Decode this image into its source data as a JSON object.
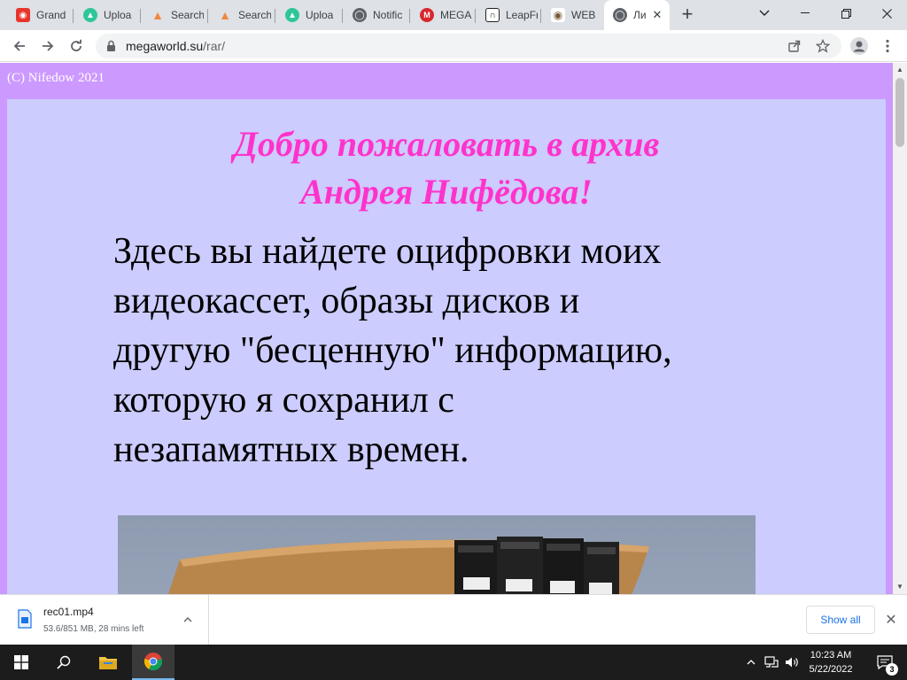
{
  "browser": {
    "tabs": [
      {
        "label": "Grand",
        "icon": "red-bag-icon",
        "color": "#e8352b"
      },
      {
        "label": "Uploa",
        "icon": "upload-logo-icon",
        "color": "#2fc59b"
      },
      {
        "label": "Search",
        "icon": "person-orange-icon",
        "color": "#f0883e"
      },
      {
        "label": "Search",
        "icon": "person-orange-icon",
        "color": "#f0883e"
      },
      {
        "label": "Uploa",
        "icon": "upload-logo-icon",
        "color": "#2fc59b"
      },
      {
        "label": "Notific",
        "icon": "globe-icon",
        "color": "#5f6368"
      },
      {
        "label": "MEGA",
        "icon": "mega-logo-icon",
        "color": "#d9272e"
      },
      {
        "label": "LeapFr",
        "icon": "museum-icon",
        "color": "#202124"
      },
      {
        "label": "WEB",
        "icon": "eye-icon",
        "color": "#7a5c3a"
      },
      {
        "label": "Ли",
        "icon": "globe-icon",
        "color": "#5f6368"
      }
    ],
    "active_tab_index": 9,
    "url_domain": "megaworld.su",
    "url_path": "/rar/"
  },
  "page": {
    "copyright": "(C) Nifedow 2021",
    "welcome_line1": "Добро пожаловать в архив",
    "welcome_line2": "Андрея Нифёдова!",
    "intro_lines": [
      "Здесь вы найдете оцифровки моих",
      "видеокассет, образы дисков и",
      "другую \"бесценную\" информацию,",
      "которую я сохранил с",
      "незапамятных времен."
    ],
    "background_color": "#cc99ff",
    "panel_color": "#ccccff",
    "heading_color": "#ff33cc"
  },
  "downloads": {
    "filename": "rec01.mp4",
    "status": "53.6/851 MB, 28 mins left",
    "show_all_label": "Show all"
  },
  "taskbar": {
    "time": "10:23 AM",
    "date": "5/22/2022",
    "notification_count": "3"
  }
}
